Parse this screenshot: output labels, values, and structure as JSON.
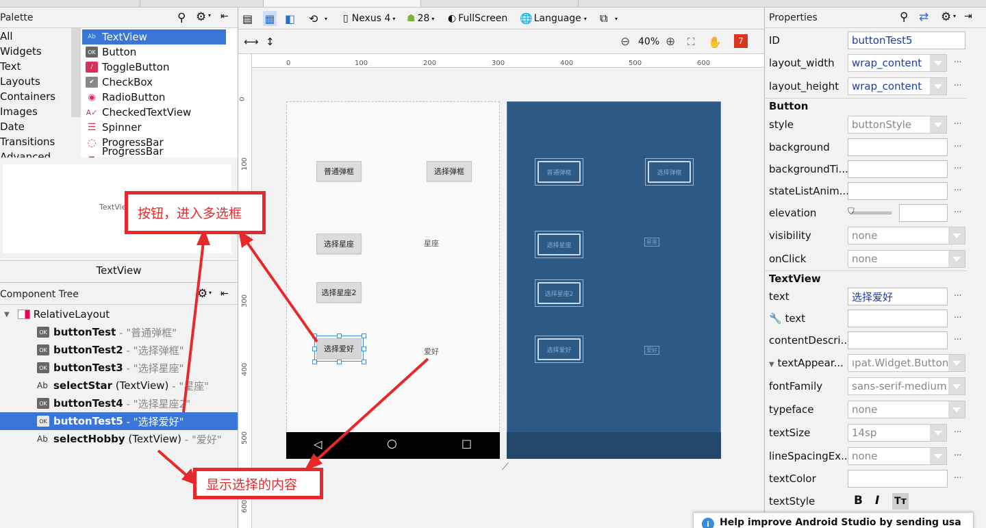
{
  "palette": {
    "title": "Palette",
    "categories": [
      "All",
      "Widgets",
      "Text",
      "Layouts",
      "Containers",
      "Images",
      "Date",
      "Transitions",
      "Advanced"
    ],
    "components": [
      {
        "label": "TextView",
        "icon": "Ab"
      },
      {
        "label": "Button",
        "icon": "OK"
      },
      {
        "label": "ToggleButton",
        "icon": "toggle"
      },
      {
        "label": "CheckBox",
        "icon": "check"
      },
      {
        "label": "RadioButton",
        "icon": "radio"
      },
      {
        "label": "CheckedTextView",
        "icon": "checked"
      },
      {
        "label": "Spinner",
        "icon": "spinner"
      },
      {
        "label": "ProgressBar",
        "icon": "progress"
      },
      {
        "label": "ProgressBar (Horizontal)",
        "icon": "progressh"
      }
    ],
    "preview_text": "TextView",
    "preview_caption": "TextView"
  },
  "component_tree": {
    "title": "Component Tree",
    "root": "RelativeLayout",
    "items": [
      {
        "icon": "OK",
        "name": "buttonTest",
        "type": "",
        "text": "- \"普通弹框\""
      },
      {
        "icon": "OK",
        "name": "buttonTest2",
        "type": "",
        "text": "- \"选择弹框\""
      },
      {
        "icon": "OK",
        "name": "buttonTest3",
        "type": "",
        "text": "- \"选择星座\""
      },
      {
        "icon": "Ab",
        "name": "selectStar",
        "type": "(TextView)",
        "text": "- \"星座\""
      },
      {
        "icon": "OK",
        "name": "buttonTest4",
        "type": "",
        "text": "- \"选择星座2\""
      },
      {
        "icon": "OK",
        "name": "buttonTest5",
        "type": "",
        "text": "- \"选择爱好\""
      },
      {
        "icon": "Ab",
        "name": "selectHobby",
        "type": "(TextView)",
        "text": "- \"爱好\""
      }
    ]
  },
  "toolbar": {
    "device": "Nexus 4",
    "api": "28",
    "theme": "FullScreen",
    "language": "Language",
    "zoom": "40%",
    "error_count": "7"
  },
  "ruler": {
    "h": [
      "0",
      "100",
      "200",
      "300",
      "400",
      "500",
      "600"
    ],
    "v": [
      "0",
      "100",
      "200",
      "300",
      "400",
      "500",
      "600"
    ]
  },
  "design": {
    "buttons": [
      "普通弹框",
      "选择弹框",
      "选择星座",
      "选择星座2",
      "选择爱好"
    ],
    "textviews": [
      "星座",
      "爱好"
    ]
  },
  "blueprint": {
    "buttons": [
      "普通弹框",
      "选择弹框",
      "选择星座",
      "选择星座2",
      "选择爱好"
    ],
    "textviews": [
      "星座",
      "爱好"
    ]
  },
  "annotations": {
    "callout1": "按钮，进入多选框",
    "callout2": "显示选择的内容"
  },
  "properties": {
    "title": "Properties",
    "id_label": "ID",
    "id_value": "buttonTest5",
    "layout_width_label": "layout_width",
    "layout_width": "wrap_content",
    "layout_height_label": "layout_height",
    "layout_height": "wrap_content",
    "section_button": "Button",
    "style_label": "style",
    "style": "buttonStyle",
    "background_label": "background",
    "background_tint_label": "backgroundTi...",
    "state_list_label": "stateListAnim...",
    "elevation_label": "elevation",
    "visibility_label": "visibility",
    "visibility": "none",
    "onclick_label": "onClick",
    "onclick": "none",
    "section_textview": "TextView",
    "text_label": "text",
    "text_value": "选择爱好",
    "tools_text_label": "text",
    "content_desc_label": "contentDescri...",
    "text_appearance_label": "textAppear...",
    "text_appearance": "ıpat.Widget.Button",
    "font_family_label": "fontFamily",
    "font_family": "sans-serif-medium",
    "typeface_label": "typeface",
    "typeface": "none",
    "text_size_label": "textSize",
    "text_size": "14sp",
    "line_spacing_label": "lineSpacingEx...",
    "line_spacing": "none",
    "text_color_label": "textColor",
    "text_style_label": "textStyle",
    "ellipsis": "..."
  },
  "help_banner": "Help improve Android Studio by sending usa",
  "colors": {
    "accent": "#3a76d8",
    "callout": "#e8292b",
    "blueprint": "#2c5a85"
  }
}
